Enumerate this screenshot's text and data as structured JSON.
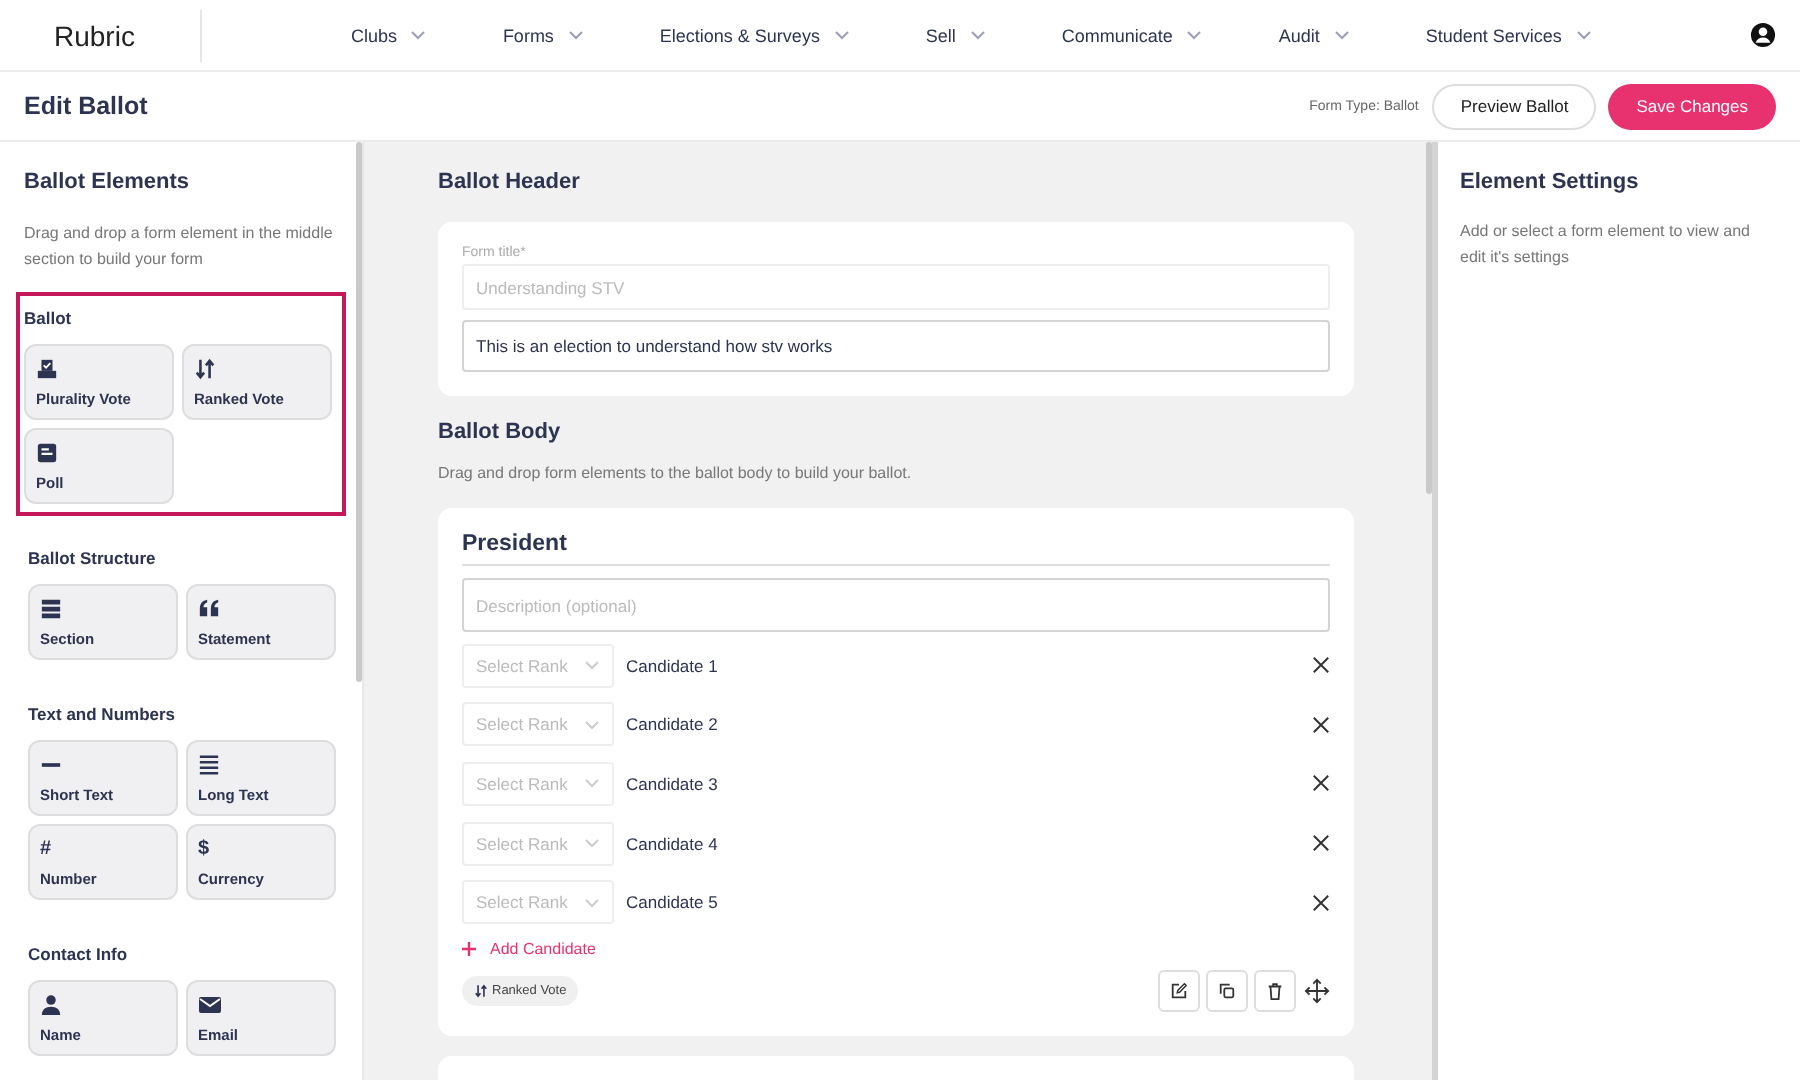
{
  "nav": {
    "logo": "Rubric",
    "items": [
      {
        "label": "Clubs"
      },
      {
        "label": "Forms"
      },
      {
        "label": "Elections & Surveys"
      },
      {
        "label": "Sell"
      },
      {
        "label": "Communicate"
      },
      {
        "label": "Audit"
      },
      {
        "label": "Student Services"
      }
    ]
  },
  "page": {
    "title": "Edit Ballot",
    "form_type": "Form Type: Ballot",
    "preview_button": "Preview Ballot",
    "save_button": "Save Changes"
  },
  "elements_panel": {
    "title": "Ballot Elements",
    "description": "Drag and drop a form element in the middle section to build your form",
    "groups": [
      {
        "title": "Ballot",
        "highlighted": true,
        "items": [
          {
            "kind": "plurality",
            "label": "Plurality Vote"
          },
          {
            "kind": "ranked",
            "label": "Ranked Vote"
          },
          {
            "kind": "poll",
            "label": "Poll"
          }
        ]
      },
      {
        "title": "Ballot Structure",
        "highlighted": false,
        "items": [
          {
            "kind": "section",
            "label": "Section"
          },
          {
            "kind": "statement",
            "label": "Statement"
          }
        ]
      },
      {
        "title": "Text and Numbers",
        "highlighted": false,
        "items": [
          {
            "kind": "short",
            "label": "Short Text"
          },
          {
            "kind": "long",
            "label": "Long Text"
          },
          {
            "kind": "glyph",
            "glyph": "#",
            "label": "Number"
          },
          {
            "kind": "glyph",
            "glyph": "$",
            "label": "Currency"
          }
        ]
      },
      {
        "title": "Contact Info",
        "highlighted": false,
        "items": [
          {
            "kind": "name",
            "label": "Name"
          },
          {
            "kind": "email",
            "label": "Email"
          }
        ]
      }
    ]
  },
  "ballot_header": {
    "title": "Ballot Header",
    "form_title_label": "Form title*",
    "form_title_placeholder": "Understanding STV",
    "description_value": "This is an election to understand how stv works"
  },
  "ballot_body": {
    "title": "Ballot Body",
    "description": "Drag and drop form elements to the ballot body to build your ballot.",
    "questions": [
      {
        "title": "President",
        "description_placeholder": "Description (optional)",
        "candidates": [
          {
            "rank_placeholder": "Select Rank",
            "name": "Candidate 1"
          },
          {
            "rank_placeholder": "Select Rank",
            "name": "Candidate 2"
          },
          {
            "rank_placeholder": "Select Rank",
            "name": "Candidate 3"
          },
          {
            "rank_placeholder": "Select Rank",
            "name": "Candidate 4"
          },
          {
            "rank_placeholder": "Select Rank",
            "name": "Candidate 5"
          }
        ],
        "add_label": "Add Candidate",
        "type_tag": {
          "kind": "ranked",
          "label": "Ranked Vote"
        }
      }
    ]
  },
  "settings_panel": {
    "title": "Element Settings",
    "description": "Add or select a form element to view and edit it's settings"
  }
}
